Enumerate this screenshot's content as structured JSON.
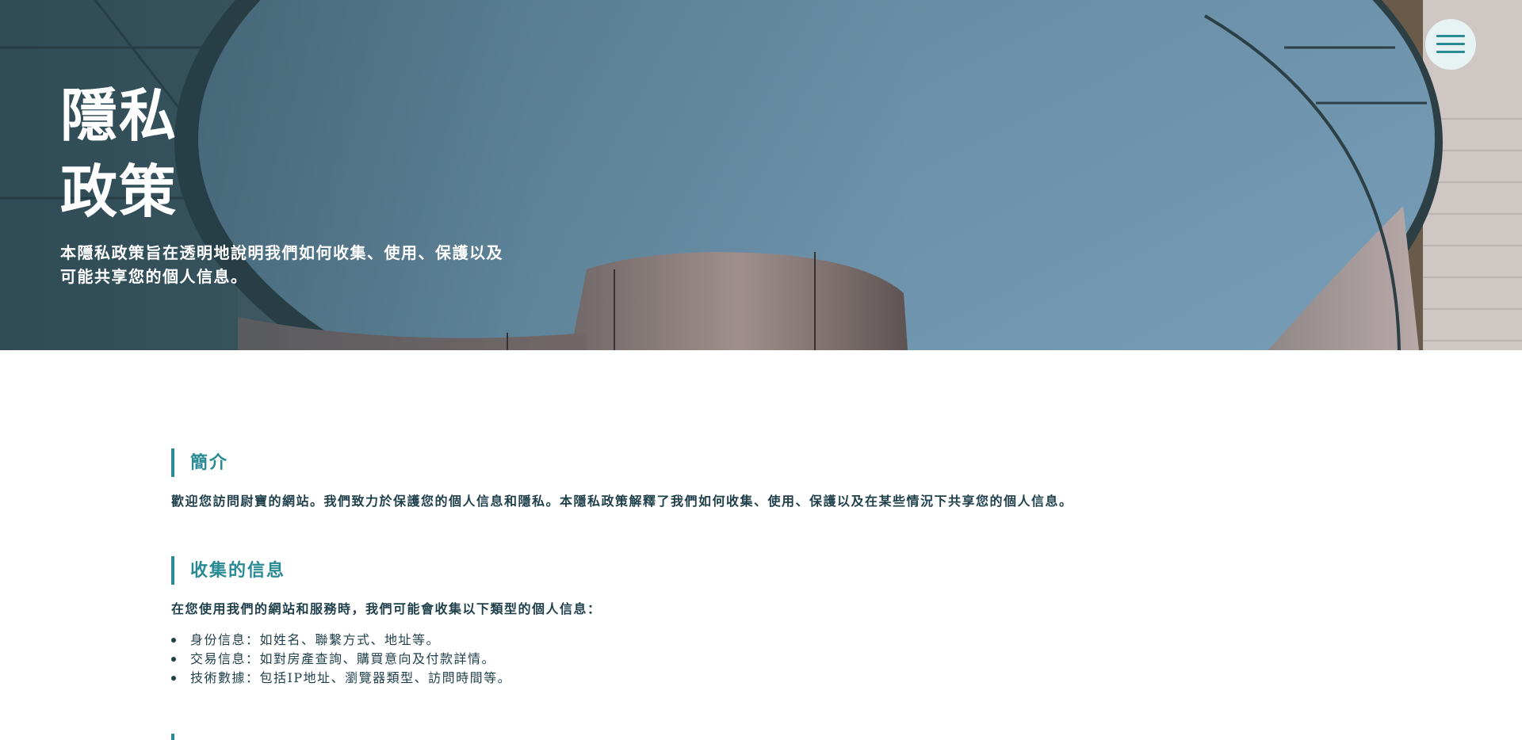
{
  "hero": {
    "title_line1": "隱私",
    "title_line2": "政策",
    "subtitle": "本隱私政策旨在透明地說明我們如何收集、使用、保護以及可能共享您的個人信息。",
    "image": "curved-architecture-sky-background"
  },
  "menu": {
    "icon": "hamburger-menu-icon"
  },
  "sections": [
    {
      "title": "簡介",
      "text": "歡迎您訪問尉寶的網站。我們致力於保護您的個人信息和隱私。本隱私政策解釋了我們如何收集、使用、保護以及在某些情況下共享您的個人信息。"
    },
    {
      "title": "收集的信息",
      "text": "在您使用我們的網站和服務時，我們可能會收集以下類型的個人信息：",
      "items": [
        "身份信息：如姓名、聯繫方式、地址等。",
        "交易信息：如對房產查詢、購買意向及付款詳情。",
        "技術數據：包括IP地址、瀏覽器類型、訪問時間等。"
      ]
    }
  ],
  "colors": {
    "accent": "#2a8a94",
    "text": "#1f3f4a",
    "menu_bg": "#e7f2f2"
  }
}
